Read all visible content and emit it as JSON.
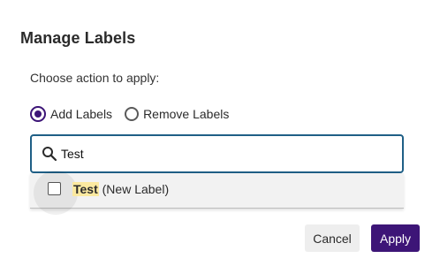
{
  "dialog": {
    "title": "Manage Labels",
    "prompt": "Choose action to apply:",
    "actions": {
      "add_label": "Add Labels",
      "remove_label": "Remove Labels",
      "selected": "add"
    },
    "search": {
      "value": "Test",
      "icon": "search-icon"
    },
    "results": [
      {
        "match": "Test",
        "suffix": " (New Label)",
        "checked": false
      }
    ],
    "buttons": {
      "cancel": "Cancel",
      "apply": "Apply"
    },
    "colors": {
      "accent": "#3d1577",
      "focus_border": "#1f5f86",
      "highlight": "#fbe9a0"
    }
  }
}
